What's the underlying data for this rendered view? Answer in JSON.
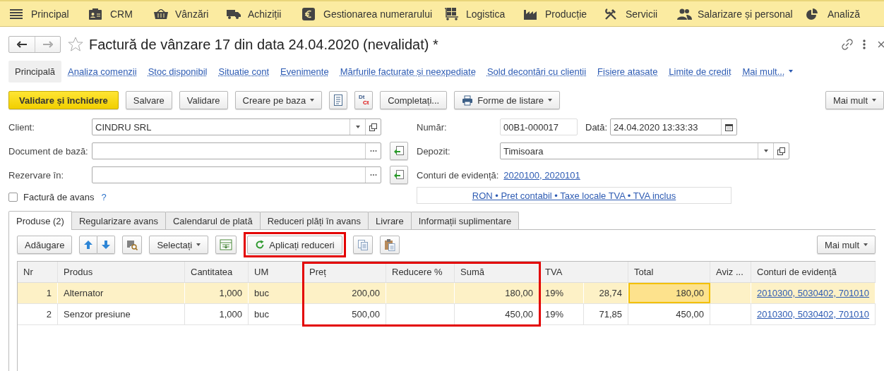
{
  "menu": [
    {
      "label": "Principal"
    },
    {
      "label": "CRM"
    },
    {
      "label": "Vânzări"
    },
    {
      "label": "Achiziții"
    },
    {
      "label": "Gestionarea numerarului"
    },
    {
      "label": "Logistica"
    },
    {
      "label": "Producție"
    },
    {
      "label": "Servicii"
    },
    {
      "label": "Salarizare și personal"
    },
    {
      "label": "Analiză"
    }
  ],
  "document": {
    "title": "Factură de vânzare 17 din data 24.04.2020 (nevalidat) *",
    "favorite": false
  },
  "sections": [
    {
      "label": "Principală",
      "selected": true
    },
    {
      "label": "Analiza comenzii",
      "selected": false
    },
    {
      "label": "Stoc disponibil",
      "selected": false
    },
    {
      "label": "Situatie cont",
      "selected": false
    },
    {
      "label": "Evenimente",
      "selected": false
    },
    {
      "label": "Mărfurile facturate și neexpediate",
      "selected": false
    },
    {
      "label": "Sold decontări cu clientii",
      "selected": false
    },
    {
      "label": "Fisiere atasate",
      "selected": false
    },
    {
      "label": "Limite de credit",
      "selected": false
    },
    {
      "label": "Mai mult...",
      "selected": false
    }
  ],
  "toolbar": [
    {
      "kind": "primary",
      "label": "Validare și închidere"
    },
    {
      "kind": "plain",
      "label": "Salvare"
    },
    {
      "kind": "plain",
      "label": "Validare"
    },
    {
      "kind": "dropdown",
      "label": "Creare pe baza"
    },
    {
      "kind": "report"
    },
    {
      "kind": "dtct",
      "label": "Dt",
      "label_2": "Ct"
    },
    {
      "kind": "plain",
      "label": "Completați..."
    },
    {
      "kind": "print",
      "label": "Forme de listare"
    }
  ],
  "toolbar_more": "Mai mult",
  "fields_left": [
    {
      "label": "Client:",
      "value": "CINDRU SRL",
      "kind": "select"
    },
    {
      "label": "Document de bază:",
      "kind": "choose"
    },
    {
      "label": "Rezervare în:",
      "kind": "choose"
    }
  ],
  "advance_invoice": {
    "label": "Factură de avans",
    "checked": false,
    "help": "?"
  },
  "number": {
    "label": "Număr:",
    "value": "00B1-000017"
  },
  "date": {
    "label": "Dată:",
    "value": "24.04.2020 13:33:33"
  },
  "warehouse": {
    "label": "Depozit:",
    "value": "Timisoara"
  },
  "accounts": {
    "label": "Conturi de evidență:",
    "value": "2020100, 2020101"
  },
  "price_info": "RON • Pret contabil • Taxe locale TVA • TVA inclus",
  "tabs": [
    {
      "label": "Produse (2)",
      "selected": true
    },
    {
      "label": "Regularizare avans",
      "selected": false
    },
    {
      "label": "Calendarul de plată",
      "selected": false
    },
    {
      "label": "Reduceri plăți în avans",
      "selected": false
    },
    {
      "label": "Livrare",
      "selected": false
    },
    {
      "label": "Informații suplimentare",
      "selected": false
    }
  ],
  "table_toolbar": [
    {
      "kind": "plain",
      "label": "Adăugare"
    },
    {
      "kind": "updown"
    },
    {
      "kind": "barcode"
    },
    {
      "kind": "dropdown",
      "label": "Selectați"
    },
    {
      "kind": "fill"
    },
    {
      "kind": "refresh",
      "label": "Aplicați reduceri",
      "highlighted": true
    },
    {
      "kind": "copy"
    },
    {
      "kind": "paste"
    }
  ],
  "table_more": "Mai mult",
  "table": {
    "columns": [
      {
        "label": "Nr",
        "highlighted": false
      },
      {
        "label": "Produs",
        "highlighted": false
      },
      {
        "label": "Cantitatea",
        "highlighted": false
      },
      {
        "label": "UM",
        "highlighted": false
      },
      {
        "label": "Preț",
        "highlighted": true
      },
      {
        "label": "Reducere %",
        "highlighted": true
      },
      {
        "label": "Sumă",
        "highlighted": true
      },
      {
        "label": "TVA",
        "highlighted": false
      },
      {
        "label": "Total",
        "highlighted": false,
        "current": true
      },
      {
        "label": "Aviz ...",
        "highlighted": false
      },
      {
        "label": "Conturi de evidență",
        "highlighted": false
      }
    ],
    "rows": [
      {
        "nr": "1",
        "product": "Alternator",
        "quantity": "1,000",
        "unit": "buc",
        "price": "200,00",
        "amount": "180,00",
        "vat_rate": "19%",
        "vat": "28,74",
        "total": "180,00",
        "accounts": "2010300, 5030402, 701010",
        "selected": true
      },
      {
        "nr": "2",
        "product": "Senzor presiune",
        "quantity": "1,000",
        "unit": "buc",
        "price": "500,00",
        "amount": "450,00",
        "vat_rate": "19%",
        "vat": "71,85",
        "total": "450,00",
        "accounts": "2010300, 5030402, 701010",
        "selected": false
      }
    ]
  }
}
